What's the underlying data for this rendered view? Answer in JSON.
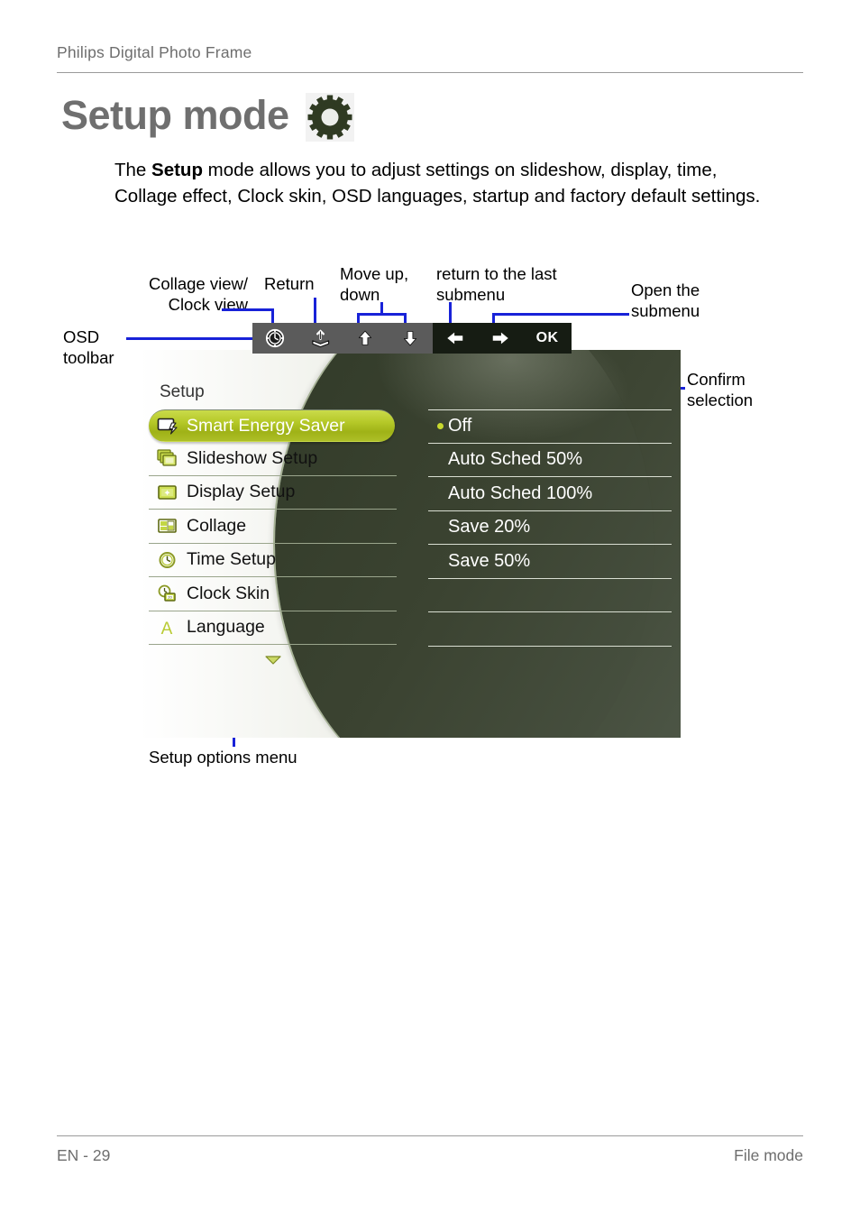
{
  "header": {
    "title": "Philips Digital Photo Frame"
  },
  "page_title": {
    "text": "Setup mode",
    "icon": "gear-icon"
  },
  "intro": {
    "before": "The ",
    "bold": "Setup",
    "after": " mode allows you to adjust settings on slideshow, display, time, Collage effect, Clock skin, OSD languages, startup and factory default settings."
  },
  "annotations": {
    "collage_clock_view": "Collage view/\nClock view",
    "return": "Return",
    "move_up_down": "Move up,\ndown",
    "return_last_submenu": "return to the last\nsubmenu",
    "open_submenu": "Open the\nsubmenu",
    "osd_toolbar": "OSD\ntoolbar",
    "confirm_selection": "Confirm\nselection",
    "setup_options_menu": "Setup options menu"
  },
  "osd_toolbar": {
    "buttons": [
      {
        "name": "clock-view-icon",
        "label": ""
      },
      {
        "name": "return-icon",
        "label": ""
      },
      {
        "name": "arrow-up-icon",
        "label": ""
      },
      {
        "name": "arrow-down-icon",
        "label": ""
      },
      {
        "name": "arrow-left-icon",
        "label": ""
      },
      {
        "name": "arrow-right-icon",
        "label": ""
      },
      {
        "name": "ok-button",
        "label": "OK"
      }
    ],
    "ok_label": "OK"
  },
  "setup_menu": {
    "title": "Setup",
    "items": [
      {
        "label": "Smart Energy Saver",
        "icon": "energy-saver-icon",
        "selected": true
      },
      {
        "label": "Slideshow Setup",
        "icon": "slideshow-icon",
        "selected": false
      },
      {
        "label": "Display Setup",
        "icon": "display-icon",
        "selected": false
      },
      {
        "label": "Collage",
        "icon": "collage-icon",
        "selected": false
      },
      {
        "label": "Time Setup",
        "icon": "clock-icon",
        "selected": false
      },
      {
        "label": "Clock Skin",
        "icon": "clock-skin-icon",
        "selected": false
      },
      {
        "label": "Language",
        "icon": "language-a-icon",
        "selected": false
      }
    ],
    "more_indicator": "chevron-down-icon"
  },
  "submenu": {
    "items": [
      {
        "label": "Off",
        "selected": true
      },
      {
        "label": "Auto Sched 50%",
        "selected": false
      },
      {
        "label": "Auto Sched 100%",
        "selected": false
      },
      {
        "label": "Save 20%",
        "selected": false
      },
      {
        "label": "Save 50%",
        "selected": false
      },
      {
        "label": "",
        "selected": false
      },
      {
        "label": "",
        "selected": false
      }
    ]
  },
  "footer": {
    "left": "EN - 29",
    "right": "File mode"
  },
  "colors": {
    "accent_green": "#b6c929",
    "leader_blue": "#1822d8",
    "screen_dark": "#39412f",
    "header_gray": "#6e6e6e"
  }
}
